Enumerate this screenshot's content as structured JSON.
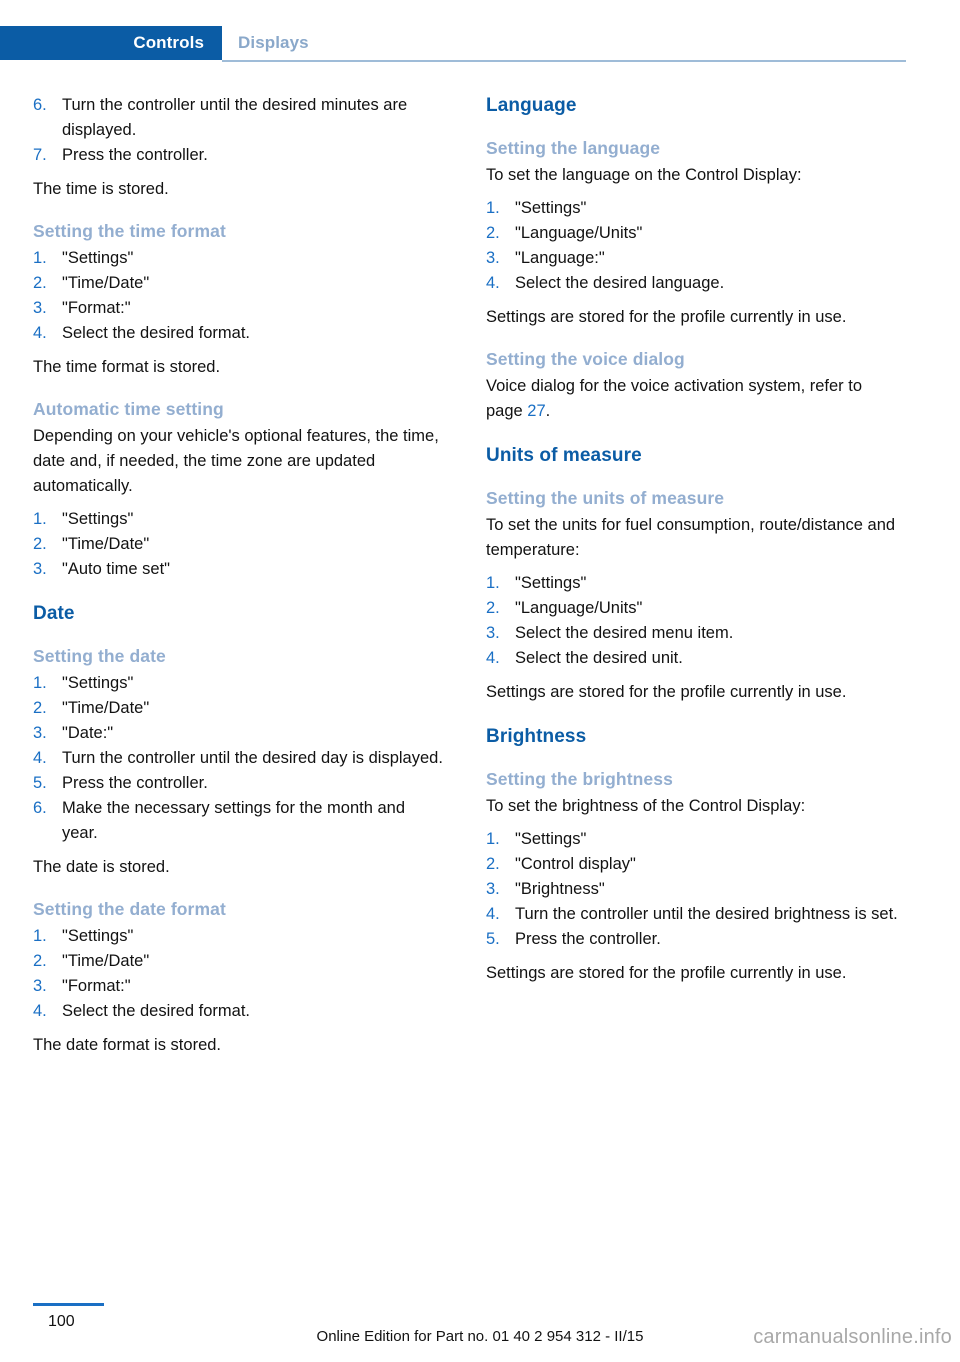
{
  "header": {
    "active_tab": "Controls",
    "inactive_tab": "Displays",
    "active_tab_bg": "#0b5ca5",
    "inactive_tab_color": "#8aa8ca"
  },
  "colors": {
    "section_heading": "#0b5ca5",
    "subheading": "#93aed0",
    "list_number": "#1a6fc4",
    "body_text": "#121212",
    "xref": "#1a6fc4",
    "watermark": "#a8a8a8"
  },
  "left_column": {
    "steps_time_continued": [
      {
        "num": "6.",
        "text": "Turn the controller until the desired minutes are displayed."
      },
      {
        "num": "7.",
        "text": "Press the controller."
      }
    ],
    "time_stored_note": "The time is stored.",
    "time_format": {
      "heading": "Setting the time format",
      "steps": [
        {
          "num": "1.",
          "text": "\"Settings\""
        },
        {
          "num": "2.",
          "text": "\"Time/Date\""
        },
        {
          "num": "3.",
          "text": "\"Format:\""
        },
        {
          "num": "4.",
          "text": "Select the desired format."
        }
      ],
      "note": "The time format is stored."
    },
    "automatic_time": {
      "heading": "Automatic time setting",
      "intro": "Depending on your vehicle's optional features, the time, date and, if needed, the time zone are updated automatically.",
      "steps": [
        {
          "num": "1.",
          "text": "\"Settings\""
        },
        {
          "num": "2.",
          "text": "\"Time/Date\""
        },
        {
          "num": "3.",
          "text": "\"Auto time set\""
        }
      ]
    },
    "date_section": {
      "heading": "Date",
      "setting_the_date": {
        "heading": "Setting the date",
        "steps": [
          {
            "num": "1.",
            "text": "\"Settings\""
          },
          {
            "num": "2.",
            "text": "\"Time/Date\""
          },
          {
            "num": "3.",
            "text": "\"Date:\""
          },
          {
            "num": "4.",
            "text": "Turn the controller until the desired day is displayed."
          },
          {
            "num": "5.",
            "text": "Press the controller."
          },
          {
            "num": "6.",
            "text": "Make the necessary settings for the month and year."
          }
        ],
        "note": "The date is stored."
      },
      "date_format": {
        "heading": "Setting the date format",
        "steps": [
          {
            "num": "1.",
            "text": "\"Settings\""
          },
          {
            "num": "2.",
            "text": "\"Time/Date\""
          },
          {
            "num": "3.",
            "text": "\"Format:\""
          },
          {
            "num": "4.",
            "text": "Select the desired format."
          }
        ],
        "note": "The date format is stored."
      }
    }
  },
  "right_column": {
    "language_section": {
      "heading": "Language",
      "setting_the_language": {
        "heading": "Setting the language",
        "intro": "To set the language on the Control Display:",
        "steps": [
          {
            "num": "1.",
            "text": "\"Settings\""
          },
          {
            "num": "2.",
            "text": "\"Language/Units\""
          },
          {
            "num": "3.",
            "text": "\"Language:\""
          },
          {
            "num": "4.",
            "text": "Select the desired language."
          }
        ],
        "note": "Settings are stored for the profile currently in use."
      },
      "voice_dialog": {
        "heading": "Setting the voice dialog",
        "text_before": "Voice dialog for the voice activation system, refer to page ",
        "page_ref": "27",
        "text_after": "."
      }
    },
    "units_section": {
      "heading": "Units of measure",
      "setting_the_units": {
        "heading": "Setting the units of measure",
        "intro": "To set the units for fuel consumption, route/distance and temperature:",
        "steps": [
          {
            "num": "1.",
            "text": "\"Settings\""
          },
          {
            "num": "2.",
            "text": "\"Language/Units\""
          },
          {
            "num": "3.",
            "text": "Select the desired menu item."
          },
          {
            "num": "4.",
            "text": "Select the desired unit."
          }
        ],
        "note": "Settings are stored for the profile currently in use."
      }
    },
    "brightness_section": {
      "heading": "Brightness",
      "setting_the_brightness": {
        "heading": "Setting the brightness",
        "intro": "To set the brightness of the Control Display:",
        "steps": [
          {
            "num": "1.",
            "text": "\"Settings\""
          },
          {
            "num": "2.",
            "text": "\"Control display\""
          },
          {
            "num": "3.",
            "text": "\"Brightness\""
          },
          {
            "num": "4.",
            "text": "Turn the controller until the desired brightness is set."
          },
          {
            "num": "5.",
            "text": "Press the controller."
          }
        ],
        "note": "Settings are stored for the profile currently in use."
      }
    }
  },
  "footer": {
    "page_number": "100",
    "edition": "Online Edition for Part no. 01 40 2 954 312 - II/15",
    "watermark": "carmanualsonline.info"
  }
}
